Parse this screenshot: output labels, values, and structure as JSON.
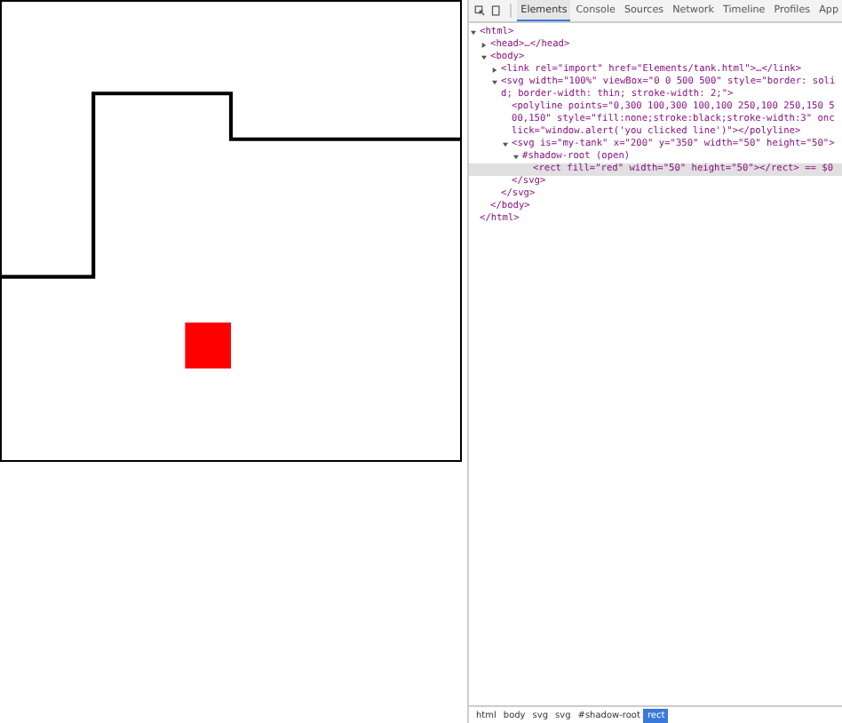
{
  "devtools": {
    "tabs": [
      {
        "label": "Elements",
        "selected": true
      },
      {
        "label": "Console",
        "selected": false
      },
      {
        "label": "Sources",
        "selected": false
      },
      {
        "label": "Network",
        "selected": false
      },
      {
        "label": "Timeline",
        "selected": false
      },
      {
        "label": "Profiles",
        "selected": false
      },
      {
        "label": "App",
        "selected": false
      }
    ],
    "dom_tree": [
      {
        "text": "<html>",
        "expanded": true,
        "selected": false,
        "closing": "</html>",
        "children": [
          {
            "text": "<head>…</head>",
            "expanded": false,
            "selected": false
          },
          {
            "text": "<body>",
            "expanded": true,
            "selected": false,
            "closing": "</body>",
            "children": [
              {
                "text": "<link rel=\"import\" href=\"Elements/tank.html\">…</link>",
                "expanded": false,
                "selected": false
              },
              {
                "text": "<svg width=\"100%\" viewBox=\"0 0 500 500\" style=\"border: solid; border-width: thin; stroke-width: 2;\">",
                "expanded": true,
                "selected": false,
                "closing": "</svg>",
                "children": [
                  {
                    "text": "<polyline points=\"0,300 100,300 100,100 250,100 250,150 500,150\" style=\"fill:none;stroke:black;stroke-width:3\" onclick=\"window.alert('you clicked line')\"></polyline>",
                    "selected": false
                  },
                  {
                    "text": "<svg is=\"my-tank\" x=\"200\" y=\"350\" width=\"50\" height=\"50\">",
                    "expanded": true,
                    "selected": false,
                    "closing": "</svg>",
                    "children": [
                      {
                        "text": "#shadow-root (open)",
                        "expanded": true,
                        "selected": false,
                        "children": [
                          {
                            "text": "<rect fill=\"red\" width=\"50\" height=\"50\"></rect> == $0",
                            "selected": true
                          }
                        ]
                      }
                    ]
                  }
                ]
              }
            ]
          }
        ]
      }
    ],
    "breadcrumbs": [
      {
        "label": "html",
        "selected": false
      },
      {
        "label": "body",
        "selected": false
      },
      {
        "label": "svg",
        "selected": false
      },
      {
        "label": "svg",
        "selected": false
      },
      {
        "label": "#shadow-root",
        "selected": false
      },
      {
        "label": "rect",
        "selected": true
      }
    ]
  }
}
